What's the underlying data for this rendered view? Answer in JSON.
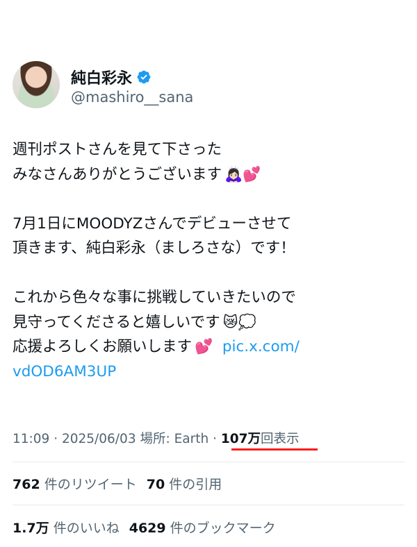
{
  "user": {
    "display_name": "純白彩永",
    "handle": "@mashiro__sana",
    "verified_color": "#1d9bf0",
    "avatar_icon": "profile-photo"
  },
  "tweet": {
    "line1": "週刊ポストさんを見て下さった",
    "line2": "みなさんありがとうございます",
    "line2_emoji": "🙇🏻‍♀️💕",
    "line4": "7月1日にMOODYZさんでデビューさせて",
    "line5": "頂きます、純白彩永（ましろさな）です！",
    "line7": "これから色々な事に挑戦していきたいので",
    "line8": "見守ってくださると嬉しいです",
    "line8_emoji": "😿💭",
    "line9": "応援よろしくお願いします",
    "line9_emoji": "💕",
    "link_part1": "pic.x.com/",
    "link_part2": "vdOD6AM3UP"
  },
  "meta": {
    "time_date": "11:09 · 2025/06/03",
    "location": "場所: Earth ·",
    "views_num": "107万",
    "views_label": "回表示",
    "highlight_color": "#ff1a1a"
  },
  "stats": {
    "retweets_num": "762",
    "retweets_label": "件のリツイート",
    "quotes_num": "70",
    "quotes_label": "件の引用",
    "likes_num": "1.7万",
    "likes_label": "件のいいね",
    "bookmarks_num": "4629",
    "bookmarks_label": "件のブックマーク"
  }
}
